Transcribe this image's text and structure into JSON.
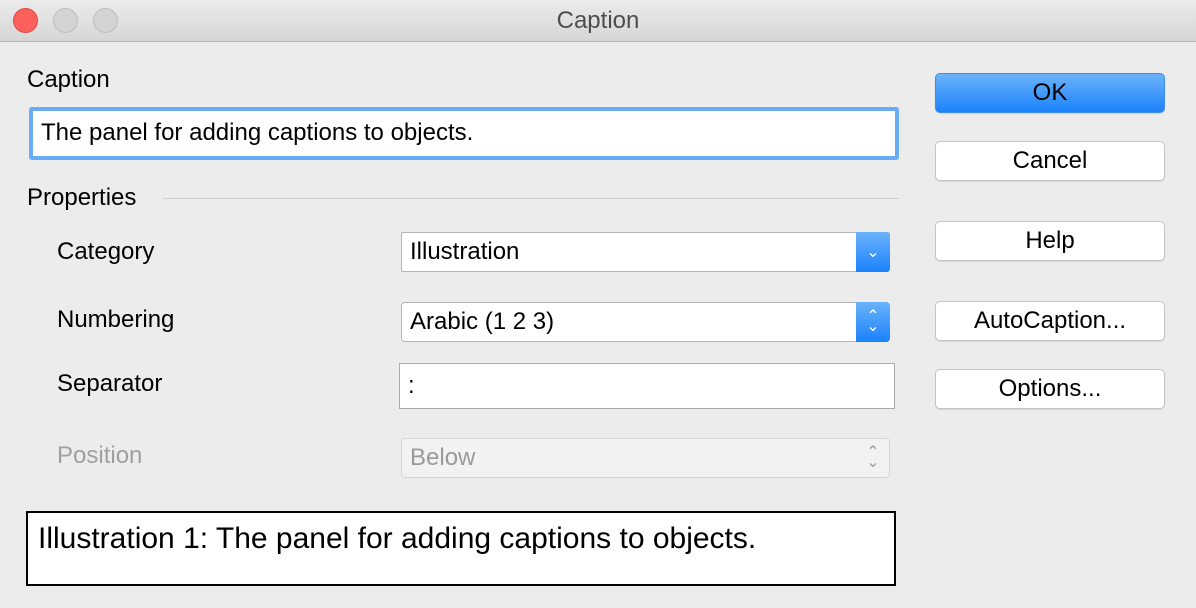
{
  "window": {
    "title": "Caption"
  },
  "caption": {
    "label": "Caption",
    "value": "The panel for adding captions to objects."
  },
  "properties": {
    "heading": "Properties",
    "category": {
      "label": "Category",
      "value": "Illustration"
    },
    "numbering": {
      "label": "Numbering",
      "value": "Arabic (1 2 3)"
    },
    "separator": {
      "label": "Separator",
      "value": ":"
    },
    "position": {
      "label": "Position",
      "value": "Below"
    }
  },
  "preview": "Illustration 1: The panel for adding captions to objects.",
  "buttons": {
    "ok": "OK",
    "cancel": "Cancel",
    "help": "Help",
    "autocaption": "AutoCaption...",
    "options": "Options..."
  }
}
